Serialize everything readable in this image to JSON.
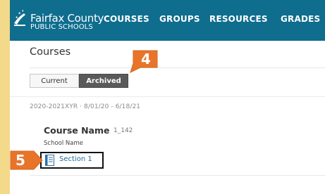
{
  "header": {
    "brand_line1": "Fairfax County",
    "brand_line2": "PUBLIC SCHOOLS",
    "nav": [
      "COURSES",
      "GROUPS",
      "RESOURCES",
      "GRADES"
    ]
  },
  "main": {
    "title": "Courses",
    "tabs": [
      {
        "label": "Current",
        "selected": false
      },
      {
        "label": "Archived",
        "selected": true
      }
    ],
    "term": "2020-2021XYR · 8/01/20 - 6/18/21",
    "course": {
      "name": "Course Name",
      "code": "1_142",
      "school": "School Name",
      "section_label": "Section 1"
    }
  },
  "annotations": {
    "step4": "4",
    "step5": "5",
    "badge_color": "#e8742a"
  },
  "colors": {
    "topbar": "#0f6d8e",
    "frame": "#f3d98a",
    "link": "#1f6a9e"
  }
}
